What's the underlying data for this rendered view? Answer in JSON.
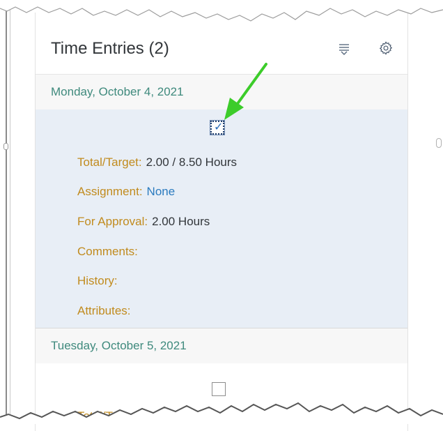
{
  "panel": {
    "title": "Time Entries (2)",
    "sort_icon": "sort-lines-icon",
    "settings_icon": "gear-icon"
  },
  "groups": [
    {
      "date": "Monday, October 4, 2021",
      "checked": true,
      "fields": {
        "total_target_label": "Total/Target:",
        "total_target_value": "2.00 / 8.50 Hours",
        "assignment_label": "Assignment:",
        "assignment_value": "None",
        "for_approval_label": "For Approval:",
        "for_approval_value": "2.00 Hours",
        "comments_label": "Comments:",
        "history_label": "History:",
        "attributes_label": "Attributes:"
      }
    },
    {
      "date": "Tuesday, October 5, 2021",
      "checked": false,
      "fields": {
        "total_target_label": "Total/Target:"
      }
    }
  ],
  "colors": {
    "accent_date": "#3f8a7d",
    "field_label": "#c18b1e",
    "link": "#2b7bbf",
    "selected_row": "#e8eef6",
    "annotation_arrow": "#3ccc2a"
  },
  "annotation": {
    "arrow_icon": "green-arrow-icon"
  }
}
